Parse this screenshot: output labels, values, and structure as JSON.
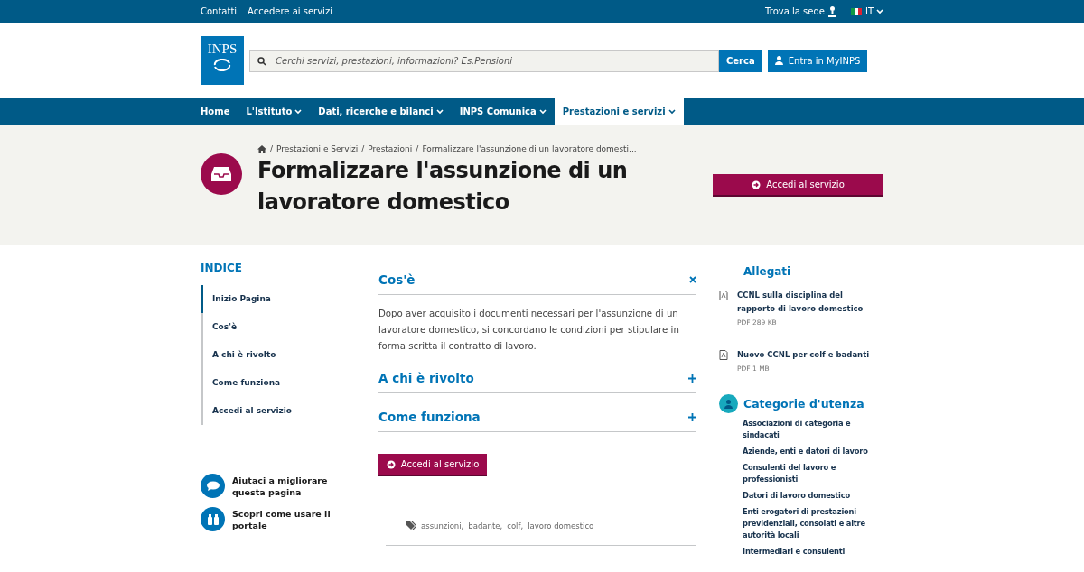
{
  "top_bar": {
    "links": [
      "Contatti",
      "Accedere ai servizi"
    ],
    "find_office": "Trova la sede",
    "language": "IT"
  },
  "header": {
    "logo": "INPS",
    "search": {
      "placeholder": "Cerchi servizi, prestazioni, informazioni? Es.Pensioni",
      "button": "Cerca"
    },
    "login": "Entra in MyINPS"
  },
  "nav": [
    {
      "label": "Home",
      "dropdown": false,
      "selected": false
    },
    {
      "label": "L'Istituto",
      "dropdown": true,
      "selected": false
    },
    {
      "label": "Dati, ricerche e bilanci",
      "dropdown": true,
      "selected": false
    },
    {
      "label": "INPS Comunica",
      "dropdown": true,
      "selected": false
    },
    {
      "label": "Prestazioni e servizi",
      "dropdown": true,
      "selected": true
    }
  ],
  "hero": {
    "breadcrumb": [
      {
        "separator": "/",
        "label": "Prestazioni e Servizi"
      },
      {
        "separator": "/",
        "label": "Prestazioni"
      },
      {
        "separator": "/",
        "label": "Formalizzare l'assunzione di un lavoratore domesti..."
      }
    ],
    "title": "Formalizzare l'assunzione di un lavoratore domestico",
    "button": "Accedi al servizio"
  },
  "index": {
    "title": "INDICE",
    "items": [
      {
        "label": "Inizio Pagina",
        "selected": true
      },
      {
        "label": "Cos'è",
        "selected": false
      },
      {
        "label": "A chi è rivolto",
        "selected": false
      },
      {
        "label": "Come funziona",
        "selected": false
      },
      {
        "label": "Accedi al servizio",
        "selected": false
      }
    ]
  },
  "help_links": [
    {
      "kind": "feedback",
      "label": "Aiutaci a migliorare questa pagina"
    },
    {
      "kind": "guide",
      "label": "Scopri come usare il portale"
    }
  ],
  "sections": [
    {
      "title": "Cos'è",
      "expanded": true,
      "body": "Dopo aver acquisito i documenti necessari per l'assunzione di un lavoratore domestico, si concordano le condizioni per stipulare in forma scritta il contratto di lavoro."
    },
    {
      "title": "A chi è rivolto",
      "expanded": false
    },
    {
      "title": "Come funziona",
      "expanded": false
    }
  ],
  "service_button": "Accedi al servizio",
  "tags": [
    "assunzioni,",
    "badante,",
    "colf,",
    "lavoro domestico"
  ],
  "attachments": {
    "title": "Allegati",
    "items": [
      {
        "label": "CCNL sulla disciplina del rapporto di lavoro domestico",
        "meta": "PDF 289 KB"
      },
      {
        "label": "Nuovo CCNL per colf e badanti",
        "meta": "PDF 1 MB"
      }
    ]
  },
  "categories": {
    "title": "Categorie d'utenza",
    "items": [
      "Associazioni di categoria e sindacati",
      "Aziende, enti e datori di lavoro",
      "Consulenti del lavoro e professionisti",
      "Datori di lavoro domestico",
      "Enti erogatori di prestazioni previdenziali, consolati e altre autorità locali",
      "Intermediari e consulenti"
    ]
  }
}
